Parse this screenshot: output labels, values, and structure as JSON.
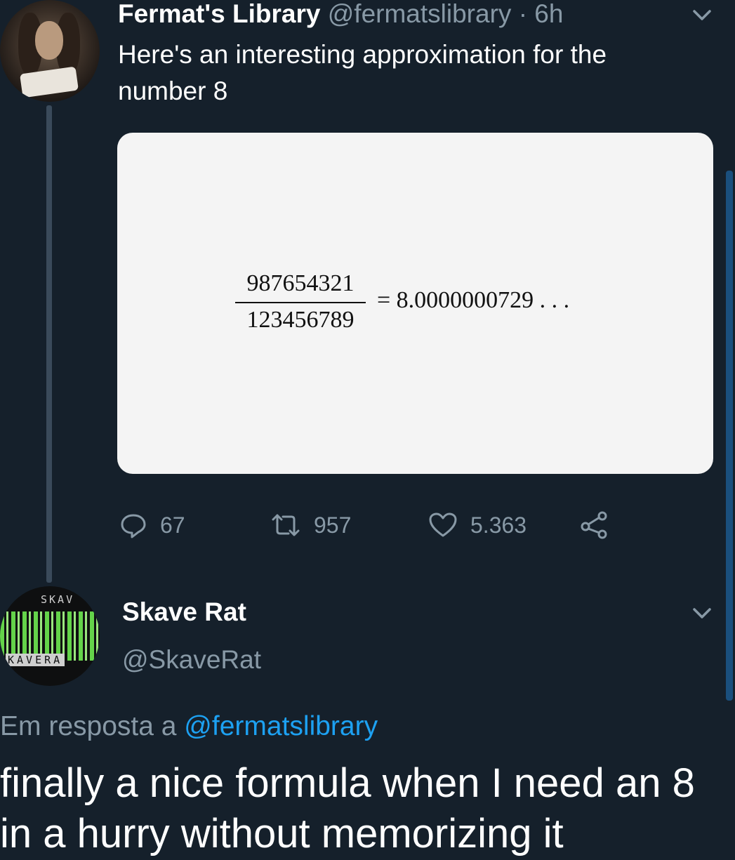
{
  "tweet": {
    "author_name": "Fermat's Library",
    "author_handle": "@fermatslibrary",
    "time": "· 6h",
    "text": "Here's an interesting approximation for the number 8",
    "formula": {
      "numerator": "987654321",
      "denominator": "123456789",
      "result": "= 8.0000000729 . . ."
    },
    "actions": {
      "replies": "67",
      "retweets": "957",
      "likes": "5.363"
    }
  },
  "reply": {
    "author_name": "Skave Rat",
    "author_handle": "@SkaveRat",
    "avatar_text_top": "SKAV",
    "avatar_text_bottom": "KAVERA",
    "reply_prefix": "Em resposta a",
    "reply_mention": "@fermatslibrary",
    "text": "finally a nice formula when I need an 8 in a hurry without memorizing it"
  },
  "colors": {
    "background": "#15202b",
    "secondary_text": "#8899a6",
    "link": "#1da1f2"
  }
}
